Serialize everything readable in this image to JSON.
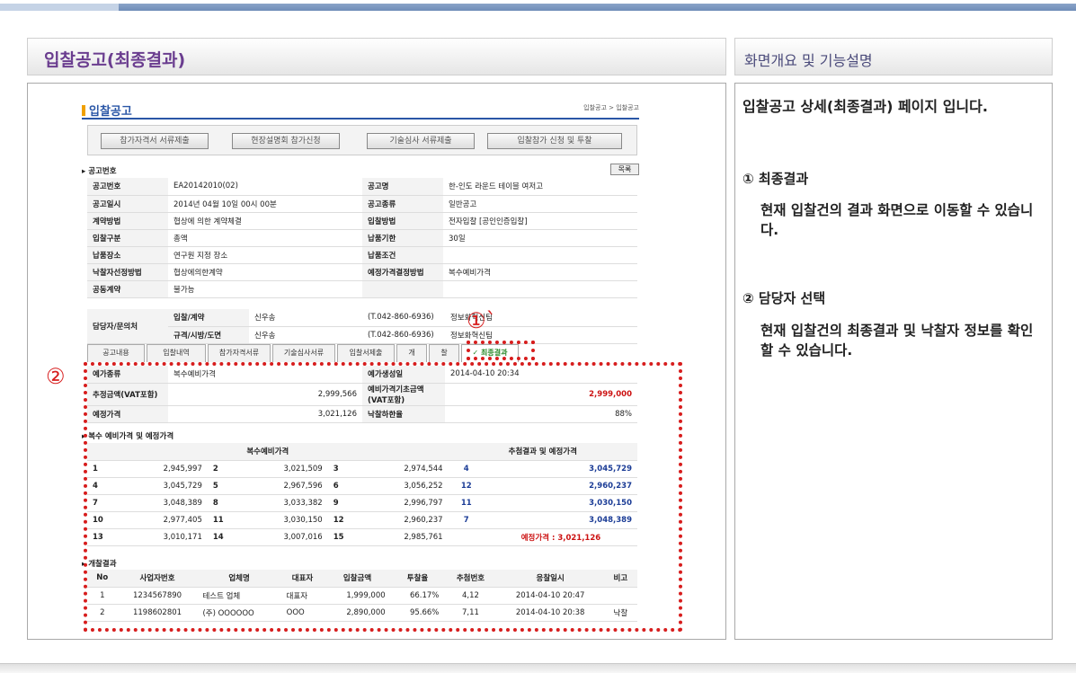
{
  "header": {
    "left_title": "입찰공고(최종결과)",
    "right_title": "화면개요 및 기능설명"
  },
  "description": {
    "intro": "입찰공고 상세(최종결과) 페이지 입니다.",
    "sections": [
      {
        "title": "① 최종결과",
        "body": "현재 입찰건의 결과 화면으로 이동할 수 있습니다."
      },
      {
        "title": "② 담당자 선택",
        "body": "현재 입찰건의 최종결과 및 낙찰자 정보를 확인 할 수 있습니다."
      }
    ]
  },
  "screenshot": {
    "title": "입찰공고",
    "breadcrumb": "입찰공고 > 입찰공고",
    "buttons": [
      "참가자격서 서류제출",
      "현장설명회 참가신청",
      "기술심사 서류제출",
      "입찰참가 신청 및 투찰"
    ],
    "section_label": "공고번호",
    "list_button": "목록",
    "info_rows": [
      [
        "공고번호",
        "EA20142010(02)",
        "공고명",
        "한-인도 라운드 테이블 여저고"
      ],
      [
        "공고일시",
        "2014년 04월 10일 00시 00분",
        "공고종류",
        "일반공고"
      ],
      [
        "계약방법",
        "협상에 의한 계약체결",
        "입찰방법",
        "전자입찰 [공인인증입찰]"
      ],
      [
        "입찰구분",
        "총액",
        "납품기한",
        "30일"
      ],
      [
        "납품장소",
        "연구원 지정 장소",
        "납품조건",
        ""
      ],
      [
        "낙찰자선정방법",
        "협상에의한계약",
        "예정가격결정방법",
        "복수예비가격"
      ],
      [
        "공동계약",
        "불가능",
        "",
        ""
      ]
    ],
    "contact": {
      "label": "담당자/문의처",
      "rows": [
        [
          "입찰/계약",
          "신우송",
          "(T.042-860-6936)",
          "정보화혁신팀"
        ],
        [
          "규격/시방/도면",
          "신우송",
          "(T.042-860-6936)",
          "정보화혁신팀"
        ]
      ]
    },
    "tabs": [
      "공고내용",
      "입찰내역",
      "참가자격서류",
      "기술심사서류",
      "입찰서제출",
      "개",
      "찰",
      "✓ 최종결과"
    ],
    "price_rows": [
      [
        "예가종류",
        "복수예비가격",
        "예가생성일",
        "2014-04-10 20:34"
      ],
      [
        "추정금액(VAT포함)",
        "2,999,566",
        "예비가격기초금액 (VAT포함)",
        "2,999,000"
      ],
      [
        "예정가격",
        "3,021,126",
        "낙찰하한율",
        "88%"
      ]
    ],
    "multi_label": "복수 예비가격 및 예정가격",
    "multi_header": {
      "left": "복수예비가격",
      "right": "추첨결과 및 예정가격"
    },
    "multi_rows": [
      [
        "1",
        "2,945,997",
        "2",
        "3,021,509",
        "3",
        "2,974,544",
        "4",
        "3,045,729"
      ],
      [
        "4",
        "3,045,729",
        "5",
        "2,967,596",
        "6",
        "3,056,252",
        "12",
        "2,960,237"
      ],
      [
        "7",
        "3,048,389",
        "8",
        "3,033,382",
        "9",
        "2,996,797",
        "11",
        "3,030,150"
      ],
      [
        "10",
        "2,977,405",
        "11",
        "3,030,150",
        "12",
        "2,960,237",
        "7",
        "3,048,389"
      ],
      [
        "13",
        "3,010,171",
        "14",
        "3,007,016",
        "15",
        "2,985,761",
        "",
        "예정가격 : 3,021,126"
      ]
    ],
    "result_label": "개찰결과",
    "result_header": [
      "No",
      "사업자번호",
      "업체명",
      "대표자",
      "입찰금액",
      "투찰율",
      "추첨번호",
      "응찰일시",
      "비고"
    ],
    "result_rows": [
      [
        "1",
        "1234567890",
        "테스트 업체",
        "대표자",
        "1,999,000",
        "66.17%",
        "4,12",
        "2014-04-10 20:47",
        ""
      ],
      [
        "2",
        "1198602801",
        "(주) OOOOOO",
        "OOO",
        "2,890,000",
        "95.66%",
        "7,11",
        "2014-04-10 20:38",
        "낙찰"
      ]
    ],
    "markers": [
      "①`",
      "②"
    ]
  }
}
